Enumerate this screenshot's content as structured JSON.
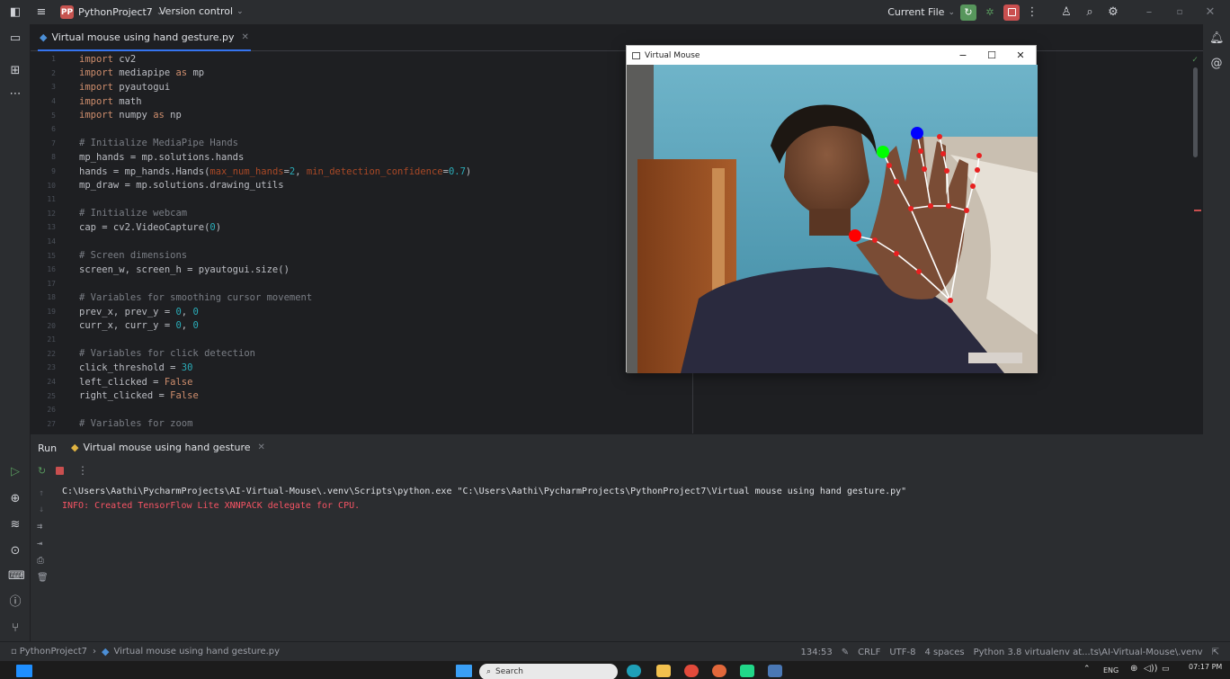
{
  "titlebar": {
    "project_badge": "PP",
    "project_name": "PythonProject7",
    "vcs_label": "Version control",
    "run_config": "Current File"
  },
  "editor": {
    "tab_label": "Virtual mouse using hand gesture.py",
    "lines": [
      {
        "n": "1",
        "segs": [
          [
            "kw",
            "import"
          ],
          [
            "t",
            " cv2"
          ]
        ]
      },
      {
        "n": "2",
        "segs": [
          [
            "kw",
            "import"
          ],
          [
            "t",
            " mediapipe "
          ],
          [
            "kw",
            "as"
          ],
          [
            "t",
            " mp"
          ]
        ]
      },
      {
        "n": "3",
        "segs": [
          [
            "kw",
            "import"
          ],
          [
            "t",
            " pyautogui"
          ]
        ]
      },
      {
        "n": "4",
        "segs": [
          [
            "kw",
            "import"
          ],
          [
            "t",
            " math"
          ]
        ]
      },
      {
        "n": "5",
        "segs": [
          [
            "kw",
            "import"
          ],
          [
            "t",
            " numpy "
          ],
          [
            "kw",
            "as"
          ],
          [
            "t",
            " np"
          ]
        ]
      },
      {
        "n": "6",
        "segs": []
      },
      {
        "n": "7",
        "segs": [
          [
            "cm",
            "# Initialize MediaPipe Hands"
          ]
        ]
      },
      {
        "n": "8",
        "segs": [
          [
            "t",
            "mp_hands = mp.solutions.hands"
          ]
        ]
      },
      {
        "n": "9",
        "segs": [
          [
            "t",
            "hands = mp_hands.Hands("
          ],
          [
            "prm",
            "max_num_hands"
          ],
          [
            "t",
            "="
          ],
          [
            "num",
            "2"
          ],
          [
            "t",
            ", "
          ],
          [
            "prm",
            "min_detection_confidence"
          ],
          [
            "t",
            "="
          ],
          [
            "num",
            "0.7"
          ],
          [
            "t",
            ")"
          ]
        ]
      },
      {
        "n": "10",
        "segs": [
          [
            "t",
            "mp_draw = mp.solutions.drawing_utils"
          ]
        ]
      },
      {
        "n": "11",
        "segs": []
      },
      {
        "n": "12",
        "segs": [
          [
            "cm",
            "# Initialize webcam"
          ]
        ]
      },
      {
        "n": "13",
        "segs": [
          [
            "t",
            "cap = cv2.VideoCapture("
          ],
          [
            "num",
            "0"
          ],
          [
            "t",
            ")"
          ]
        ]
      },
      {
        "n": "14",
        "segs": []
      },
      {
        "n": "15",
        "segs": [
          [
            "cm",
            "# Screen dimensions"
          ]
        ]
      },
      {
        "n": "16",
        "segs": [
          [
            "t",
            "screen_w, screen_h = pyautogui.size()"
          ]
        ]
      },
      {
        "n": "17",
        "segs": []
      },
      {
        "n": "18",
        "segs": [
          [
            "cm",
            "# Variables for smoothing cursor movement"
          ]
        ]
      },
      {
        "n": "19",
        "segs": [
          [
            "t",
            "prev_x, prev_y = "
          ],
          [
            "num",
            "0"
          ],
          [
            "t",
            ", "
          ],
          [
            "num",
            "0"
          ]
        ]
      },
      {
        "n": "20",
        "segs": [
          [
            "t",
            "curr_x, curr_y = "
          ],
          [
            "num",
            "0"
          ],
          [
            "t",
            ", "
          ],
          [
            "num",
            "0"
          ]
        ]
      },
      {
        "n": "21",
        "segs": []
      },
      {
        "n": "22",
        "segs": [
          [
            "cm",
            "# Variables for click detection"
          ]
        ]
      },
      {
        "n": "23",
        "segs": [
          [
            "t",
            "click_threshold = "
          ],
          [
            "num",
            "30"
          ]
        ]
      },
      {
        "n": "24",
        "segs": [
          [
            "t",
            "left_clicked = "
          ],
          [
            "kw",
            "False"
          ]
        ]
      },
      {
        "n": "25",
        "segs": [
          [
            "t",
            "right_clicked = "
          ],
          [
            "kw",
            "False"
          ]
        ]
      },
      {
        "n": "26",
        "segs": []
      },
      {
        "n": "27",
        "segs": [
          [
            "cm",
            "# Variables for zoom"
          ]
        ]
      }
    ]
  },
  "window": {
    "title": "Virtual Mouse",
    "minimize": "−",
    "maximize": "☐",
    "close": "✕"
  },
  "run_panel": {
    "run_tab": "Run",
    "config_tab": "Virtual mouse using hand gesture",
    "console_lines": [
      {
        "text": "C:\\Users\\Aathi\\PycharmProjects\\AI-Virtual-Mouse\\.venv\\Scripts\\python.exe \"C:\\Users\\Aathi\\PycharmProjects\\PythonProject7\\Virtual mouse using hand gesture.py\"",
        "color": "#dfe1e5"
      },
      {
        "text": "INFO: Created TensorFlow Lite XNNPACK delegate for CPU.",
        "color": "#f75464"
      }
    ]
  },
  "statusbar": {
    "breadcrumb_project": "PythonProject7",
    "breadcrumb_file": "Virtual mouse using hand gesture.py",
    "position": "134:53",
    "line_sep": "CRLF",
    "encoding": "UTF-8",
    "indent": "4 spaces",
    "interpreter": "Python 3.8 virtualenv at...ts\\AI-Virtual-Mouse\\.venv"
  },
  "taskbar": {
    "search_placeholder": "Search",
    "lang": "ENG",
    "time": "07:17 PM"
  },
  "colors": {
    "accent": "#3574f0",
    "stop_red": "#c94f4f",
    "run_green": "#57965c"
  },
  "hand_landmarks": {
    "thumb_tip_color": "#ff0000",
    "index_tip_color": "#00ff00",
    "middle_tip_color": "#0000ff"
  }
}
